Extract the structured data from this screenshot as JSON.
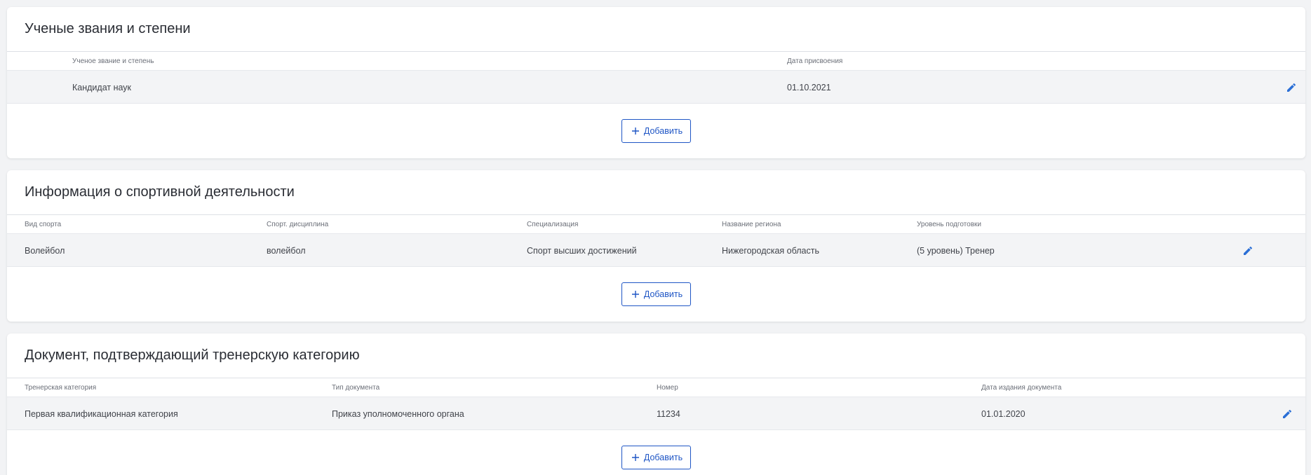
{
  "colors": {
    "accent": "#1f56c5",
    "edit_icon": "#2b6fd6",
    "row_bg": "#f3f4f6",
    "page_bg": "#f2f3f5"
  },
  "icons": {
    "add": "plus-icon",
    "edit": "pencil-icon"
  },
  "sections": [
    {
      "title": "Ученые звания и степени",
      "columns": [
        "Ученое звание и степень",
        "Дата присвоения"
      ],
      "rows": [
        [
          "Кандидат наук",
          "01.10.2021"
        ]
      ],
      "add_label": "Добавить"
    },
    {
      "title": "Информация о спортивной деятельности",
      "columns": [
        "Вид спорта",
        "Спорт. дисциплина",
        "Специализация",
        "Название региона",
        "Уровень подготовки"
      ],
      "rows": [
        [
          "Волейбол",
          "волейбол",
          "Спорт высших достижений",
          "Нижегородская область",
          "(5 уровень) Тренер"
        ]
      ],
      "add_label": "Добавить"
    },
    {
      "title": "Документ, подтверждающий тренерскую категорию",
      "columns": [
        "Тренерская категория",
        "Тип документа",
        "Номер",
        "Дата издания документа"
      ],
      "rows": [
        [
          "Первая квалификационная категория",
          "Приказ уполномоченного органа",
          "11234",
          "01.01.2020"
        ]
      ],
      "add_label": "Добавить"
    }
  ]
}
